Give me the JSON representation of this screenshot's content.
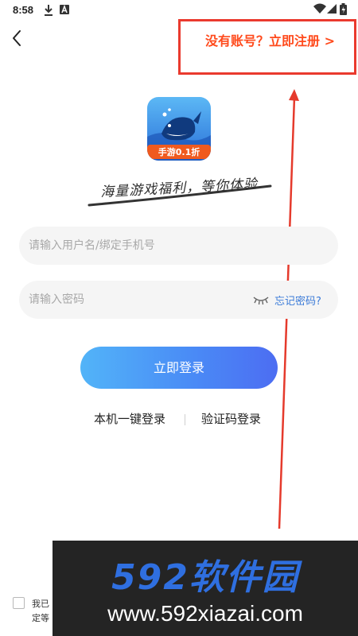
{
  "status_bar": {
    "time": "8:58",
    "icons_left": [
      "download-icon",
      "a-box-icon"
    ],
    "icons_right": [
      "wifi-icon",
      "signal-icon",
      "battery-icon"
    ]
  },
  "header": {
    "back_icon": "chevron-left-icon",
    "register_link": "没有账号？立即注册 >"
  },
  "brand": {
    "logo_badge": "手游0.1折",
    "slogan": "海量游戏福利，等你体验"
  },
  "form": {
    "username": {
      "value": "",
      "placeholder": "请输入用户名/绑定手机号"
    },
    "password": {
      "value": "",
      "placeholder": "请输入密码"
    },
    "forgot_link": "忘记密码?",
    "login_button": "立即登录"
  },
  "alt_login": {
    "one_click": "本机一键登录",
    "sms_code": "验证码登录"
  },
  "agreement": {
    "line1": "我已",
    "line2": "定等"
  },
  "watermark": {
    "title": "592软件园",
    "url": "www.592xiazai.com"
  },
  "colors": {
    "register_link": "#ff4a1c",
    "highlight_box": "#ea3a2e",
    "forgot_link": "#3b7bd8",
    "button_start": "#52b4f8",
    "button_end": "#4c6df2",
    "input_bg": "#f5f5f5"
  }
}
